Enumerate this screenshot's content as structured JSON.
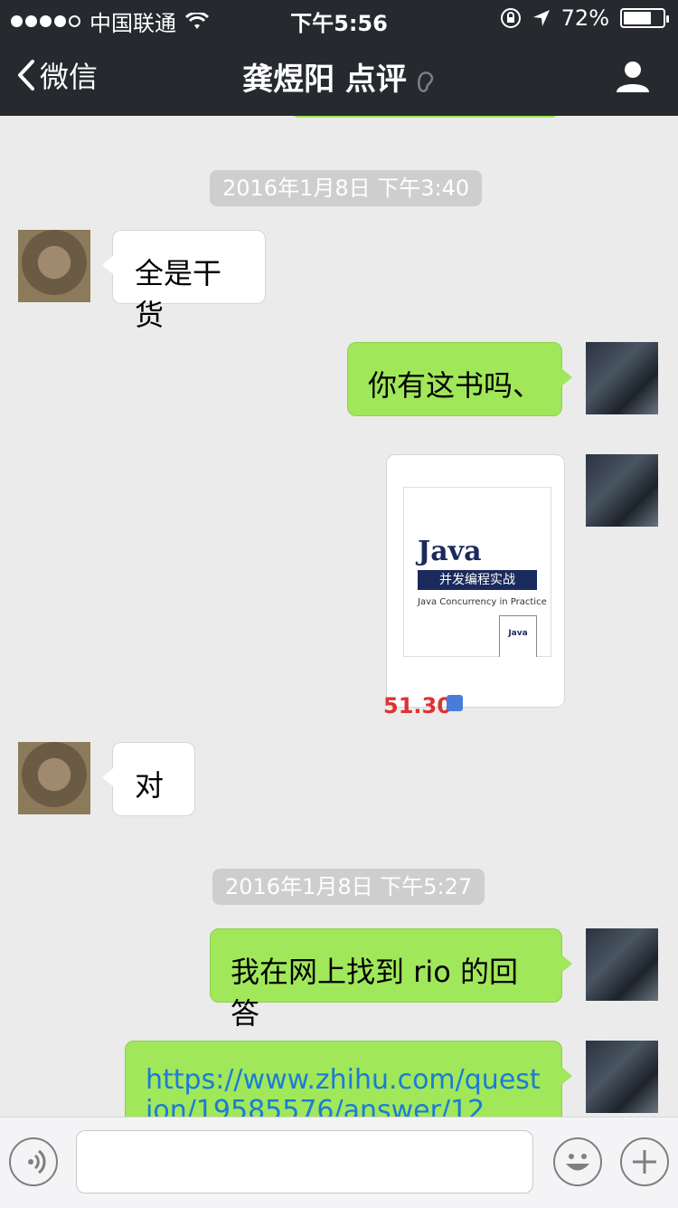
{
  "status_bar": {
    "carrier": "中国联通",
    "time": "下午5:56",
    "battery": "72%",
    "battery_level": 0.72
  },
  "nav": {
    "back_label": "微信",
    "title": "龚煜阳 点评",
    "icons": [
      "chevron-left-icon",
      "ear-icon",
      "user-icon"
    ]
  },
  "chat": {
    "timestamps": [
      "2016年1月8日 下午3:40",
      "2016年1月8日 下午5:27"
    ],
    "messages": [
      {
        "side": "left",
        "type": "text",
        "text": "全是干货"
      },
      {
        "side": "right",
        "type": "text",
        "text": "你有这书吗、"
      },
      {
        "side": "right",
        "type": "image",
        "book": {
          "title": "Java",
          "subtitle": "并发编程实战",
          "english": "Java Concurrency in Practice",
          "price": "51.30"
        }
      },
      {
        "side": "left",
        "type": "text",
        "text": "对"
      },
      {
        "side": "right",
        "type": "text",
        "text": "我在网上找到 rio 的回答"
      },
      {
        "side": "right",
        "type": "link",
        "text": "https://www.zhihu.com/question/19585576/answer/12"
      }
    ]
  },
  "input_bar": {
    "icons": [
      "voice-icon",
      "emoji-icon",
      "plus-icon"
    ]
  },
  "colors": {
    "nav_bg": "#26292e",
    "chat_bg": "#ebebeb",
    "green_bubble": "#a0e75a",
    "link": "#1b7bd8"
  }
}
